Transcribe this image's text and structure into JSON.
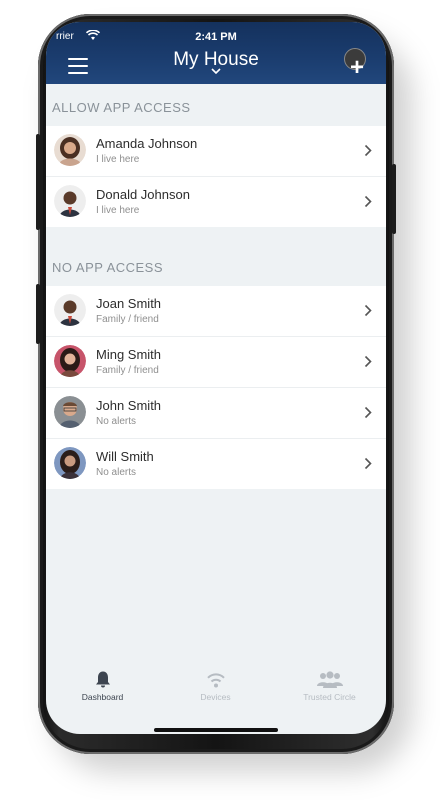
{
  "status_bar": {
    "carrier": "rrier",
    "time": "2:41 PM"
  },
  "header": {
    "title": "My House"
  },
  "sections": {
    "allow": {
      "title": "ALLOW APP ACCESS",
      "people": [
        {
          "name": "Amanda Johnson",
          "subtitle": "I live here"
        },
        {
          "name": "Donald Johnson",
          "subtitle": "I live here"
        }
      ]
    },
    "no": {
      "title": "NO APP ACCESS",
      "people": [
        {
          "name": "Joan Smith",
          "subtitle": "Family / friend"
        },
        {
          "name": "Ming Smith",
          "subtitle": "Family / friend"
        },
        {
          "name": "John Smith",
          "subtitle": "No alerts"
        },
        {
          "name": "Will Smith",
          "subtitle": "No alerts"
        }
      ]
    }
  },
  "tabs": [
    {
      "label": "Dashboard",
      "icon": "bell-icon",
      "active": true
    },
    {
      "label": "Devices",
      "icon": "wifi-icon",
      "active": false
    },
    {
      "label": "Trusted Circle",
      "icon": "people-icon",
      "active": false
    }
  ],
  "colors": {
    "header": "#1b3d6f",
    "tab_active": "#3d4550",
    "tab_inactive": "#b6bcc2",
    "background": "#eef2f4"
  }
}
